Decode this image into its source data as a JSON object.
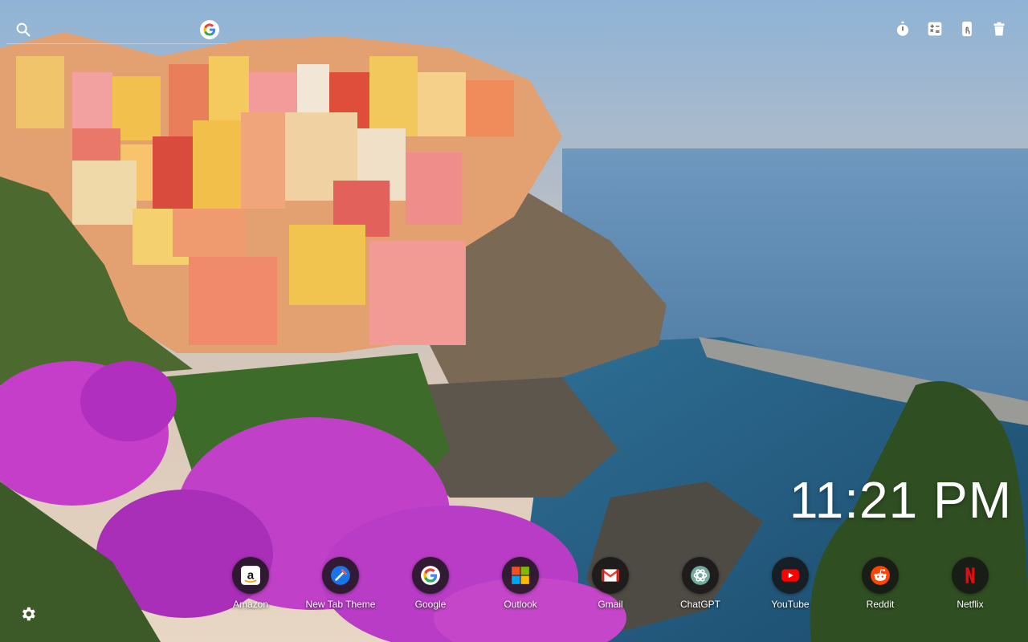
{
  "search": {
    "placeholder": "",
    "engine_icon": "google-icon"
  },
  "top_tools": [
    {
      "icon": "stopwatch-icon"
    },
    {
      "icon": "calculator-icon"
    },
    {
      "icon": "touch-icon"
    },
    {
      "icon": "trash-icon"
    }
  ],
  "clock": {
    "time": "11:21 PM"
  },
  "shortcuts": [
    {
      "label": "Amazon",
      "icon": "amazon-icon"
    },
    {
      "label": "New Tab Theme",
      "icon": "new-tab-theme-icon"
    },
    {
      "label": "Google",
      "icon": "google-icon"
    },
    {
      "label": "Outlook",
      "icon": "microsoft-icon"
    },
    {
      "label": "Gmail",
      "icon": "gmail-icon"
    },
    {
      "label": "ChatGPT",
      "icon": "chatgpt-icon"
    },
    {
      "label": "YouTube",
      "icon": "youtube-icon"
    },
    {
      "label": "Reddit",
      "icon": "reddit-icon"
    },
    {
      "label": "Netflix",
      "icon": "netflix-icon"
    }
  ],
  "settings": {
    "icon": "gear-icon"
  },
  "colors": {
    "dock_circle": "#141414",
    "youtube_red": "#FF0000",
    "reddit_orange": "#FF4500",
    "netflix_red": "#E50914"
  }
}
